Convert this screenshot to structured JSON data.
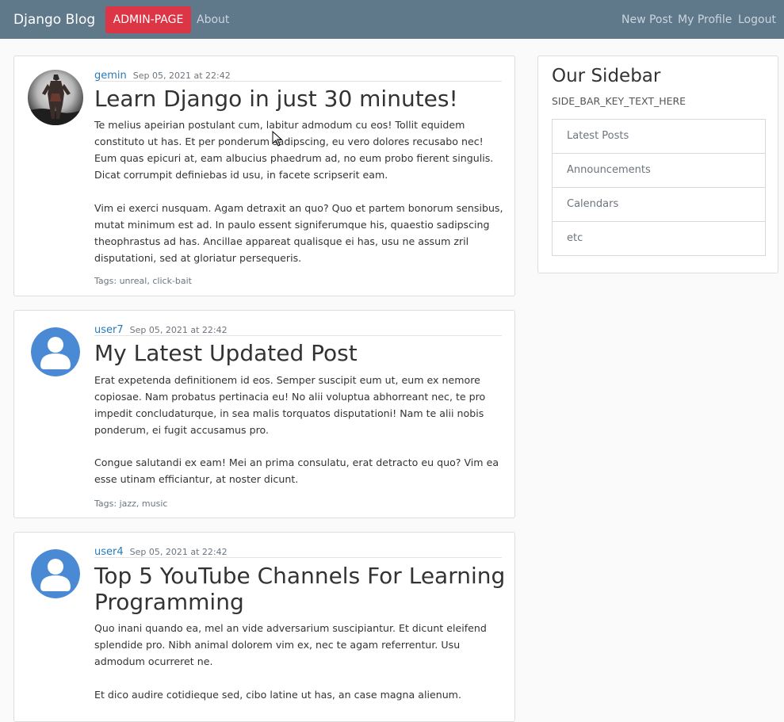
{
  "navbar": {
    "brand": "Django Blog",
    "admin_label": "ADMIN-PAGE",
    "about": "About",
    "new_post": "New Post",
    "my_profile": "My Profile",
    "logout": "Logout"
  },
  "posts": [
    {
      "author": "gemin",
      "date": "Sep 05, 2021 at 22:42",
      "title": "Learn Django in just 30 minutes!",
      "paragraphs": [
        "Te melius apeirian postulant cum, labitur admodum cu eos! Tollit equidem constituto ut has. Et per ponderum sadipscing, eu vero dolores recusabo nec! Eum quas epicuri at, eam albucius phaedrum ad, no eum probo fierent singulis. Dicat corrumpit definiebas id usu, in facete scripserit eam.",
        "Vim ei exerci nusquam. Agam detraxit an quo? Quo et partem bonorum sensibus, mutat minimum est ad. In paulo essent signiferumque his, quaestio sadipscing theophrastus ad has. Ancillae appareat qualisque ei has, usu ne assum zril disputationi, sed at gloriatur persequeris."
      ],
      "tags_label": "Tags:",
      "tags": [
        "unreal",
        "click-bait"
      ]
    },
    {
      "author": "user7",
      "date": "Sep 05, 2021 at 22:42",
      "title": "My Latest Updated Post",
      "paragraphs": [
        "Erat expetenda definitionem id eos. Semper suscipit eum ut, eum ex nemore copiosae. Nam probatus pertinacia eu! No alii voluptua abhorreant nec, te pro impedit concludaturque, in sea malis torquatos disputationi! Nam te alii nobis ponderum, ei fugit accusamus pro.",
        "Congue salutandi ex eam! Mei an prima consulatu, erat detracto eu quo? Vim ea esse utinam efficiantur, at noster dicunt."
      ],
      "tags_label": "Tags:",
      "tags": [
        "jazz",
        "music"
      ]
    },
    {
      "author": "user4",
      "date": "Sep 05, 2021 at 22:42",
      "title": "Top 5 YouTube Channels For Learning Programming",
      "paragraphs": [
        "Quo inani quando ea, mel an vide adversarium suscipiantur. Et dicunt eleifend splendide pro. Nibh animal dolorem vim ex, nec te agam referrentur. Usu admodum ocurreret ne.",
        "Et dico audire cotidieque sed, cibo latine ut has, an case magna alienum."
      ]
    }
  ],
  "sidebar": {
    "title": "Our Sidebar",
    "subtitle": "SIDE_BAR_KEY_TEXT_HERE",
    "items": [
      "Latest Posts",
      "Announcements",
      "Calendars",
      "etc"
    ]
  },
  "colors": {
    "navbar": "#5f788a",
    "admin_button": "#dc3545",
    "author_link": "#2a7ab8",
    "default_avatar": "#4a8ad4"
  }
}
